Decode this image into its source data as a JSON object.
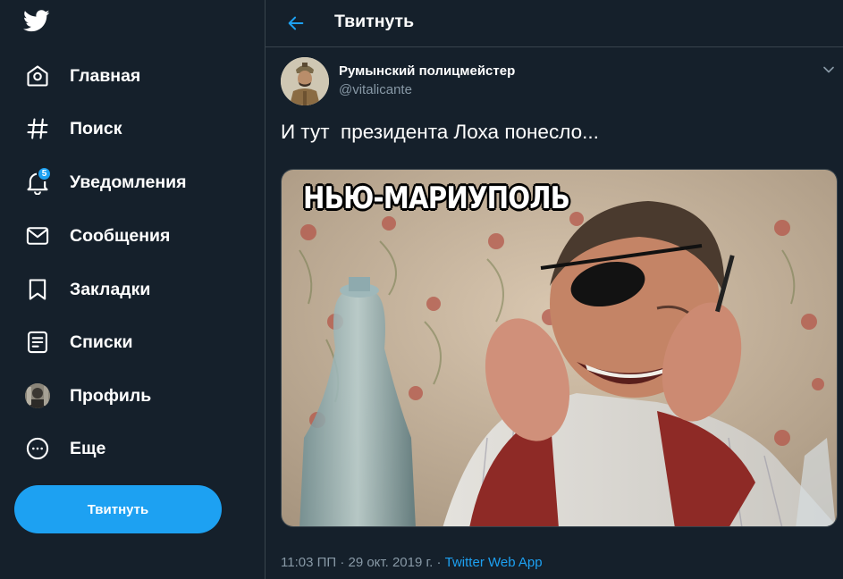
{
  "sidebar": {
    "logo_icon": "twitter-bird-icon",
    "items": [
      {
        "label": "Главная",
        "icon": "home-icon"
      },
      {
        "label": "Поиск",
        "icon": "hashtag-icon"
      },
      {
        "label": "Уведомления",
        "icon": "bell-icon",
        "badge": "5"
      },
      {
        "label": "Сообщения",
        "icon": "envelope-icon"
      },
      {
        "label": "Закладки",
        "icon": "bookmark-icon"
      },
      {
        "label": "Списки",
        "icon": "list-icon"
      },
      {
        "label": "Профиль",
        "icon": "avatar-icon"
      },
      {
        "label": "Еще",
        "icon": "more-circle-icon"
      }
    ],
    "tweet_button": "Твитнуть"
  },
  "header": {
    "back_icon": "arrow-left-icon",
    "title": "Твитнуть"
  },
  "tweet": {
    "display_name": "Румынский полицмейстер",
    "handle": "@vitalicante",
    "text": "И тут  президента Лоха понесло...",
    "media_caption": "НЬЮ-МАРИУПОЛЬ",
    "time_date": "11:03 ПП · 29 окт. 2019 г. · ",
    "source": "Twitter Web App"
  },
  "colors": {
    "background": "#15202b",
    "accent": "#1da1f2",
    "secondary_text": "#8899a6",
    "border": "#38444d"
  }
}
